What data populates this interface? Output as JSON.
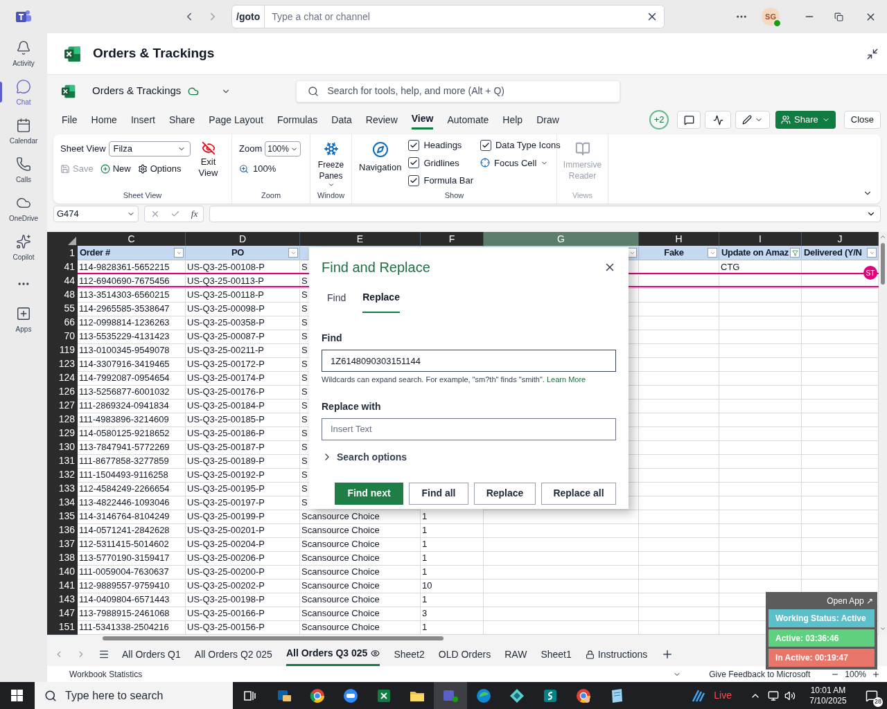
{
  "teams": {
    "search_prefix": "/goto",
    "search_placeholder": "Type a chat or channel",
    "avatar": "SG",
    "rail": [
      {
        "label": "Activity",
        "selected": false
      },
      {
        "label": "Chat",
        "selected": true
      },
      {
        "label": "Calendar",
        "selected": false
      },
      {
        "label": "Calls",
        "selected": false
      },
      {
        "label": "OneDrive",
        "selected": false
      },
      {
        "label": "Copilot",
        "selected": false
      },
      {
        "label": "Apps",
        "selected": false
      }
    ]
  },
  "app_header": {
    "title": "Orders & Trackings"
  },
  "excel": {
    "file_name": "Orders & Trackings",
    "search_placeholder": "Search for tools, help, and more (Alt + Q)",
    "menu": [
      {
        "label": "File",
        "selected": false
      },
      {
        "label": "Home",
        "selected": false
      },
      {
        "label": "Insert",
        "selected": false
      },
      {
        "label": "Share",
        "selected": false
      },
      {
        "label": "Page Layout",
        "selected": false
      },
      {
        "label": "Formulas",
        "selected": false
      },
      {
        "label": "Data",
        "selected": false
      },
      {
        "label": "Review",
        "selected": false
      },
      {
        "label": "View",
        "selected": true
      },
      {
        "label": "Automate",
        "selected": false
      },
      {
        "label": "Help",
        "selected": false
      },
      {
        "label": "Draw",
        "selected": false
      }
    ],
    "presence_count": "+2",
    "share": "Share",
    "close": "Close"
  },
  "ribbon": {
    "groups": [
      {
        "kind": "sheet_view",
        "label": "Sheet View",
        "title": "Sheet View",
        "view": "Filza",
        "save": {
          "label": "Save",
          "disabled": true
        },
        "new": "New",
        "options": "Options",
        "exit": "Exit View"
      },
      {
        "kind": "zoom",
        "label": "Zoom",
        "title": "Zoom",
        "value": "100%",
        "reset": "100%"
      },
      {
        "kind": "window",
        "label": "Window",
        "freeze": "Freeze Panes"
      },
      {
        "kind": "show",
        "label": "Show",
        "navigation": "Navigation",
        "checks": [
          {
            "label": "Headings",
            "checked": true
          },
          {
            "label": "Gridlines",
            "checked": true
          },
          {
            "label": "Formula Bar",
            "checked": true
          },
          {
            "label": "Data Type Icons",
            "checked": true
          }
        ],
        "focus": "Focus Cell"
      },
      {
        "kind": "views",
        "label": "Views",
        "reader": "Immersive Reader",
        "disabled": true
      }
    ]
  },
  "formula_bar": {
    "name_box": "G474",
    "function_label": "fx"
  },
  "sheet": {
    "columns": [
      {
        "letter": "C",
        "heading": "Order #",
        "filtered": false,
        "selected": false
      },
      {
        "letter": "D",
        "heading": "PO",
        "filtered": false,
        "selected": false
      },
      {
        "letter": "E",
        "selected": false
      },
      {
        "letter": "F",
        "selected": false
      },
      {
        "letter": "G",
        "filtered": false,
        "selected": true
      },
      {
        "letter": "H",
        "heading": "Fake",
        "filtered": false,
        "selected": false
      },
      {
        "letter": "I",
        "heading": "Update on Amaz",
        "filtered": true,
        "selected": false
      },
      {
        "letter": "J",
        "heading": "Delivered (Y/N",
        "filtered": false,
        "selected": false
      }
    ],
    "header_row": "1",
    "rows": [
      {
        "number": "41",
        "order": "114-9828361-5652215",
        "po": "US-Q3-25-00108-P",
        "column_e": "S",
        "column_i": "CTG"
      },
      {
        "number": "44",
        "order": "112-6940690-7675456",
        "po": "US-Q3-25-00113-P",
        "column_e": "S",
        "collaborator": {
          "initials": "ST",
          "color": "#e3007d"
        }
      },
      {
        "number": "48",
        "order": "113-3514303-6560215",
        "po": "US-Q3-25-00118-P",
        "column_e": "S"
      },
      {
        "number": "55",
        "order": "114-2965585-3538647",
        "po": "US-Q3-25-00098-P",
        "column_e": "S"
      },
      {
        "number": "66",
        "order": "112-0998814-1236263",
        "po": "US-Q3-25-00358-P",
        "column_e": "S"
      },
      {
        "number": "70",
        "order": "113-5535229-4131423",
        "po": "US-Q3-25-00087-P",
        "column_e": "S"
      },
      {
        "number": "119",
        "order": "113-0100345-9549078",
        "po": "US-Q3-25-00211-P",
        "column_e": "S"
      },
      {
        "number": "123",
        "order": "114-3307916-3419465",
        "po": "US-Q3-25-00172-P",
        "column_e": "S"
      },
      {
        "number": "124",
        "order": "114-7992087-0954654",
        "po": "US-Q3-25-00174-P",
        "column_e": "S"
      },
      {
        "number": "126",
        "order": "113-5256877-6001032",
        "po": "US-Q3-25-00176-P",
        "column_e": "S"
      },
      {
        "number": "127",
        "order": "111-2869324-0941834",
        "po": "US-Q3-25-00184-P",
        "column_e": "S"
      },
      {
        "number": "128",
        "order": "111-4983896-3214609",
        "po": "US-Q3-25-00185-P",
        "column_e": "S"
      },
      {
        "number": "129",
        "order": "114-0580125-9218652",
        "po": "US-Q3-25-00186-P",
        "column_e": "S"
      },
      {
        "number": "130",
        "order": "113-7847941-5772269",
        "po": "US-Q3-25-00187-P",
        "column_e": "S"
      },
      {
        "number": "131",
        "order": "111-8677858-3277859",
        "po": "US-Q3-25-00189-P",
        "column_e": "S"
      },
      {
        "number": "132",
        "order": "111-1504493-9116258",
        "po": "US-Q3-25-00192-P",
        "column_e": "S"
      },
      {
        "number": "133",
        "order": "112-4584249-2266654",
        "po": "US-Q3-25-00195-P",
        "column_e": "S"
      },
      {
        "number": "134",
        "order": "113-4822446-1093046",
        "po": "US-Q3-25-00197-P",
        "column_e": "S"
      },
      {
        "number": "135",
        "order": "114-3146764-8104249",
        "po": "US-Q3-25-00199-P",
        "column_e": "Scansource Choice",
        "column_f": "1"
      },
      {
        "number": "136",
        "order": "114-0571241-2842628",
        "po": "US-Q3-25-00201-P",
        "column_e": "Scansource Choice",
        "column_f": "1"
      },
      {
        "number": "137",
        "order": "112-5311415-5014602",
        "po": "US-Q3-25-00204-P",
        "column_e": "Scansource Choice",
        "column_f": "1"
      },
      {
        "number": "138",
        "order": "113-5770190-3159417",
        "po": "US-Q3-25-00206-P",
        "column_e": "Scansource Choice",
        "column_f": "1"
      },
      {
        "number": "140",
        "order": "111-0059004-7630637",
        "po": "US-Q3-25-00200-P",
        "column_e": "Scansource Choice",
        "column_f": "1"
      },
      {
        "number": "141",
        "order": "112-9889557-9759410",
        "po": "US-Q3-25-00202-P",
        "column_e": "Scansource Choice",
        "column_f": "10"
      },
      {
        "number": "143",
        "order": "114-0409804-6571443",
        "po": "US-Q3-25-00198-P",
        "column_e": "Scansource Choice",
        "column_f": "1"
      },
      {
        "number": "147",
        "order": "113-7988915-2461068",
        "po": "US-Q3-25-00166-P",
        "column_e": "Scansource Choice",
        "column_f": "3"
      },
      {
        "number": "151",
        "order": "111-5341338-2504216",
        "po": "US-Q3-25-00156-P",
        "column_e": "Scansource Choice",
        "column_f": "1"
      }
    ]
  },
  "dialog": {
    "title": "Find and Replace",
    "tabs": [
      {
        "label": "Find",
        "selected": false
      },
      {
        "label": "Replace",
        "selected": true
      }
    ],
    "find_label": "Find",
    "find_value": "1Z6148090303151144",
    "hint": "Wildcards can expand search. For example, \"sm?th\" finds \"smith\".",
    "hint_link": "Learn More",
    "replace_label": "Replace with",
    "replace_placeholder": "Insert Text",
    "options": {
      "label": "Search options",
      "expanded": false
    },
    "buttons": [
      {
        "label": "Find next",
        "kind": "primary"
      },
      {
        "label": "Find all",
        "kind": "secondary"
      },
      {
        "label": "Replace",
        "kind": "secondary"
      },
      {
        "label": "Replace all",
        "kind": "secondary"
      }
    ]
  },
  "sheet_tabs": [
    {
      "label": "All Orders Q1",
      "selected": false,
      "kind": "plain"
    },
    {
      "label": "All Orders Q2 025",
      "selected": false,
      "kind": "plain"
    },
    {
      "label": "All Orders Q3 025",
      "selected": true,
      "kind": "view"
    },
    {
      "label": "Sheet2",
      "selected": false,
      "kind": "plain"
    },
    {
      "label": "OLD Orders",
      "selected": false,
      "kind": "plain"
    },
    {
      "label": "RAW",
      "selected": false,
      "kind": "plain"
    },
    {
      "label": "Sheet1",
      "selected": false,
      "kind": "plain"
    },
    {
      "label": "Instructions",
      "selected": false,
      "kind": "locked"
    }
  ],
  "status_bar": {
    "statistics": "Workbook Statistics",
    "feedback": "Give Feedback to Microsoft",
    "zoom": "100%"
  },
  "tracker": {
    "open_app": "Open App ↗",
    "items": [
      {
        "label": "Working Status: Active",
        "color": "#5bc0c9"
      },
      {
        "label": "Active: 03:36:46",
        "color": "#5ed07e"
      },
      {
        "label": "In Active: 00:19:47",
        "color": "#e8766a"
      }
    ]
  },
  "taskbar": {
    "search_placeholder": "Type here to search",
    "apps": [
      {
        "selected": false
      },
      {
        "selected": false
      },
      {
        "selected": false
      },
      {
        "selected": false
      },
      {
        "selected": false
      },
      {
        "selected": true
      },
      {
        "selected": false
      },
      {
        "selected": false
      },
      {
        "selected": false
      },
      {
        "selected": false
      },
      {
        "selected": false
      }
    ],
    "weather": "Live",
    "time": "10:01 AM",
    "date": "7/10/2025",
    "notifications": "28"
  }
}
